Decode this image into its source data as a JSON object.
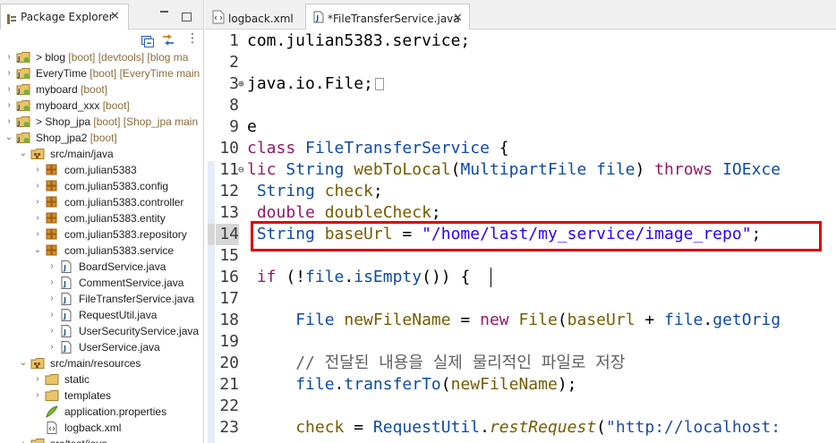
{
  "explorer": {
    "tab_label": "Package Explorer",
    "tree": [
      {
        "label": "blog",
        "deco": "[boot] [devtools] [blog ma",
        "prefix": ">",
        "level": 0,
        "expanded": false,
        "kind": "project"
      },
      {
        "label": "EveryTime",
        "deco": "[boot] [EveryTime main",
        "prefix": "",
        "level": 0,
        "expanded": false,
        "kind": "project"
      },
      {
        "label": "myboard",
        "deco": "[boot]",
        "prefix": "",
        "level": 0,
        "expanded": false,
        "kind": "project"
      },
      {
        "label": "myboard_xxx",
        "deco": "[boot]",
        "prefix": "",
        "level": 0,
        "expanded": false,
        "kind": "project"
      },
      {
        "label": "Shop_jpa",
        "deco": "[boot] [Shop_jpa main",
        "prefix": ">",
        "level": 0,
        "expanded": false,
        "kind": "project"
      },
      {
        "label": "Shop_jpa2",
        "deco": "[boot]",
        "prefix": "",
        "level": 0,
        "expanded": true,
        "kind": "project"
      },
      {
        "label": "src/main/java",
        "deco": "",
        "prefix": "",
        "level": 1,
        "expanded": true,
        "kind": "srcfolder"
      },
      {
        "label": "com.julian5383",
        "deco": "",
        "prefix": "",
        "level": 2,
        "expanded": false,
        "kind": "package"
      },
      {
        "label": "com.julian5383.config",
        "deco": "",
        "prefix": "",
        "level": 2,
        "expanded": false,
        "kind": "package"
      },
      {
        "label": "com.julian5383.controller",
        "deco": "",
        "prefix": "",
        "level": 2,
        "expanded": false,
        "kind": "package"
      },
      {
        "label": "com.julian5383.entity",
        "deco": "",
        "prefix": "",
        "level": 2,
        "expanded": false,
        "kind": "package"
      },
      {
        "label": "com.julian5383.repository",
        "deco": "",
        "prefix": "",
        "level": 2,
        "expanded": false,
        "kind": "package"
      },
      {
        "label": "com.julian5383.service",
        "deco": "",
        "prefix": "",
        "level": 2,
        "expanded": true,
        "kind": "package"
      },
      {
        "label": "BoardService.java",
        "deco": "",
        "prefix": "",
        "level": 3,
        "expanded": false,
        "kind": "java"
      },
      {
        "label": "CommentService.java",
        "deco": "",
        "prefix": "",
        "level": 3,
        "expanded": false,
        "kind": "java"
      },
      {
        "label": "FileTransferService.java",
        "deco": "",
        "prefix": "",
        "level": 3,
        "expanded": false,
        "kind": "java"
      },
      {
        "label": "RequestUtil.java",
        "deco": "",
        "prefix": "",
        "level": 3,
        "expanded": false,
        "kind": "java"
      },
      {
        "label": "UserSecurityService.java",
        "deco": "",
        "prefix": "",
        "level": 3,
        "expanded": false,
        "kind": "java"
      },
      {
        "label": "UserService.java",
        "deco": "",
        "prefix": "",
        "level": 3,
        "expanded": false,
        "kind": "java"
      },
      {
        "label": "src/main/resources",
        "deco": "",
        "prefix": "",
        "level": 1,
        "expanded": true,
        "kind": "srcfolder"
      },
      {
        "label": "static",
        "deco": "",
        "prefix": "",
        "level": 2,
        "expanded": false,
        "kind": "folder"
      },
      {
        "label": "templates",
        "deco": "",
        "prefix": "",
        "level": 2,
        "expanded": false,
        "kind": "folder"
      },
      {
        "label": "application.properties",
        "deco": "",
        "prefix": "",
        "level": 2,
        "expanded": null,
        "kind": "properties"
      },
      {
        "label": "logback.xml",
        "deco": "",
        "prefix": "",
        "level": 2,
        "expanded": null,
        "kind": "xml"
      },
      {
        "label": "src/test/java",
        "deco": "",
        "prefix": "",
        "level": 1,
        "expanded": false,
        "kind": "srcfolder"
      }
    ]
  },
  "editor": {
    "tabs": [
      {
        "label": "logback.xml",
        "active": false
      },
      {
        "label": "*FileTransferService.java",
        "active": true
      }
    ],
    "current_line": "14",
    "lines": [
      {
        "num": "1",
        "fold": "",
        "tokens": [
          [
            "",
            "com.julian5383.service;"
          ]
        ]
      },
      {
        "num": "2",
        "fold": "",
        "tokens": []
      },
      {
        "num": "3",
        "fold": "⊕",
        "tokens": [
          [
            "",
            "java.io.File;"
          ],
          [
            "box",
            ""
          ]
        ]
      },
      {
        "num": "8",
        "fold": "",
        "tokens": []
      },
      {
        "num": "9",
        "fold": "",
        "tokens": [
          [
            "",
            "e"
          ]
        ]
      },
      {
        "num": "10",
        "fold": "",
        "tokens": [
          [
            "kw",
            "class "
          ],
          [
            "ty",
            "FileTransferService"
          ],
          [
            "",
            " {"
          ]
        ]
      },
      {
        "num": "11",
        "fold": "⊖",
        "tokens": [
          [
            "kw",
            "lic "
          ],
          [
            "ty",
            "String "
          ],
          [
            "fn",
            "webToLocal"
          ],
          [
            "",
            "("
          ],
          [
            "ty",
            "MultipartFile"
          ],
          [
            "",
            " "
          ],
          [
            "ty",
            "file"
          ],
          [
            "",
            ") "
          ],
          [
            "kw",
            "throws "
          ],
          [
            "ty",
            "IOExce"
          ]
        ]
      },
      {
        "num": "12",
        "fold": "",
        "tokens": [
          [
            "",
            " "
          ],
          [
            "ty",
            "String "
          ],
          [
            "fn",
            "check"
          ],
          [
            "",
            ";"
          ]
        ]
      },
      {
        "num": "13",
        "fold": "",
        "tokens": [
          [
            "",
            " "
          ],
          [
            "kw",
            "double "
          ],
          [
            "fn",
            "doubleCheck"
          ],
          [
            "",
            ";"
          ]
        ]
      },
      {
        "num": "14",
        "fold": "",
        "tokens": [
          [
            "",
            " "
          ],
          [
            "ty",
            "String "
          ],
          [
            "fn",
            "baseUrl"
          ],
          [
            "",
            " = "
          ],
          [
            "str",
            "\"/home/last/my_service/image_repo\""
          ],
          [
            "",
            ";"
          ]
        ]
      },
      {
        "num": "15",
        "fold": "",
        "tokens": []
      },
      {
        "num": "16",
        "fold": "",
        "tokens": [
          [
            "",
            " "
          ],
          [
            "kw",
            "if "
          ],
          [
            "",
            "(!"
          ],
          [
            "ty",
            "file"
          ],
          [
            "",
            "."
          ],
          [
            "ty",
            "isEmpty"
          ],
          [
            "",
            "()) {"
          ]
        ]
      },
      {
        "num": "17",
        "fold": "",
        "tokens": []
      },
      {
        "num": "18",
        "fold": "",
        "tokens": [
          [
            "",
            "     "
          ],
          [
            "ty",
            "File "
          ],
          [
            "fn",
            "newFileName"
          ],
          [
            "",
            " = "
          ],
          [
            "kw",
            "new "
          ],
          [
            "fn",
            "File"
          ],
          [
            "",
            "("
          ],
          [
            "fn",
            "baseUrl"
          ],
          [
            "",
            " + "
          ],
          [
            "ty",
            "file"
          ],
          [
            "",
            "."
          ],
          [
            "ty",
            "getOrig"
          ]
        ]
      },
      {
        "num": "19",
        "fold": "",
        "tokens": []
      },
      {
        "num": "20",
        "fold": "",
        "tokens": [
          [
            "",
            "     "
          ],
          [
            "cmt",
            "// 전달된 내용을 실제 물리적인 파일로 저장"
          ]
        ]
      },
      {
        "num": "21",
        "fold": "",
        "tokens": [
          [
            "",
            "     "
          ],
          [
            "ty",
            "file"
          ],
          [
            "",
            "."
          ],
          [
            "ty",
            "transferTo"
          ],
          [
            "",
            "("
          ],
          [
            "fn",
            "newFileName"
          ],
          [
            "",
            ");"
          ]
        ]
      },
      {
        "num": "22",
        "fold": "",
        "tokens": []
      },
      {
        "num": "23",
        "fold": "",
        "tokens": [
          [
            "",
            "     "
          ],
          [
            "fn",
            "check"
          ],
          [
            "",
            " = "
          ],
          [
            "ty",
            "RequestUtil"
          ],
          [
            "",
            "."
          ],
          [
            "fnit",
            "restRequest"
          ],
          [
            "",
            "("
          ],
          [
            "str2",
            "\"http://localhost:"
          ]
        ]
      }
    ]
  },
  "colors": {
    "highlight_box": "#e0000a",
    "keyword": "#931a68",
    "type": "#0f4ba8",
    "field": "#745c00",
    "string": "#2a00ff"
  }
}
